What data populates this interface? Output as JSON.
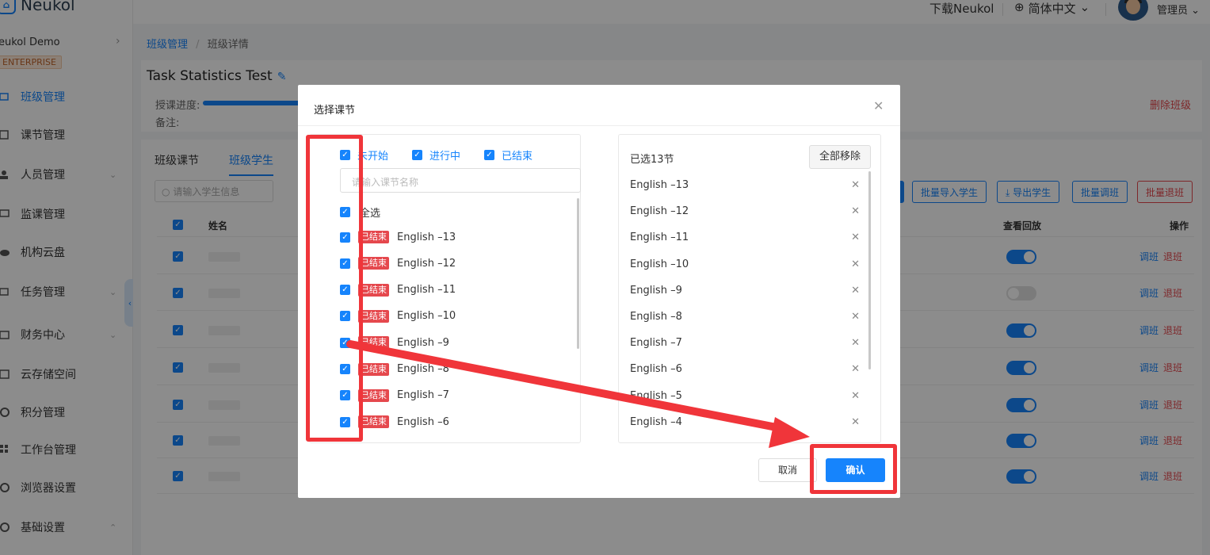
{
  "app": {
    "logo_text": "Neukol"
  },
  "sidebar": {
    "org_name": "eukol Demo",
    "org_badge": "ENTERPRISE",
    "items": [
      {
        "label": "班级管理",
        "active": true,
        "chevron": false
      },
      {
        "label": "课节管理",
        "active": false,
        "chevron": false
      },
      {
        "label": "人员管理",
        "active": false,
        "chevron": true
      },
      {
        "label": "监课管理",
        "active": false,
        "chevron": false
      },
      {
        "label": "机构云盘",
        "active": false,
        "chevron": false
      },
      {
        "label": "任务管理",
        "active": false,
        "chevron": true
      },
      {
        "label": "财务中心",
        "active": false,
        "chevron": true
      },
      {
        "label": "云存储空间",
        "active": false,
        "chevron": false
      },
      {
        "label": "积分管理",
        "active": false,
        "chevron": false
      },
      {
        "label": "工作台管理",
        "active": false,
        "chevron": false
      },
      {
        "label": "浏览器设置",
        "active": false,
        "chevron": false
      },
      {
        "label": "基础设置",
        "active": false,
        "chevron": true
      }
    ]
  },
  "header": {
    "download": "下载Neukol",
    "language": "简体中文",
    "user": "管理员"
  },
  "breadcrumb": {
    "root": "班级管理",
    "sep": "/",
    "current": "班级详情"
  },
  "class_info": {
    "title": "Task Statistics Test",
    "progress_label": "授课进度:",
    "progress_fraction": 0.62,
    "note_label": "备注:",
    "delete_label": "删除班级"
  },
  "tabs": [
    "班级课节",
    "班级学生"
  ],
  "student_search_placeholder": "请输入学生信息",
  "toolbar": {
    "import": "批量导入学生",
    "export": "导出学生",
    "transfer": "批量调班",
    "withdraw": "批量退班"
  },
  "table": {
    "col_name": "姓名",
    "col_replay": "查看回放",
    "col_ops": "操作",
    "rows": [
      {
        "replay_on": true
      },
      {
        "replay_on": false
      },
      {
        "replay_on": true
      },
      {
        "replay_on": true
      },
      {
        "replay_on": true
      },
      {
        "replay_on": true
      },
      {
        "replay_on": true
      }
    ],
    "op_transfer": "调班",
    "op_withdraw": "退班"
  },
  "modal": {
    "title": "选择课节",
    "filters": [
      "未开始",
      "进行中",
      "已结束"
    ],
    "search_placeholder": "请输入课节名称",
    "select_all": "全选",
    "lesson_tag": "已结束",
    "lessons": [
      "English –13",
      "English –12",
      "English –11",
      "English –10",
      "English –9",
      "English –8",
      "English –7",
      "English –6"
    ],
    "selected_count": "已选13节",
    "remove_all": "全部移除",
    "selected": [
      "English –13",
      "English –12",
      "English –11",
      "English –10",
      "English –9",
      "English –8",
      "English –7",
      "English –6",
      "English –5",
      "English –4"
    ],
    "cancel": "取消",
    "confirm": "确认"
  },
  "colors": {
    "accent": "#1684fc",
    "danger": "#e5484d",
    "annotation": "#f0353a"
  }
}
